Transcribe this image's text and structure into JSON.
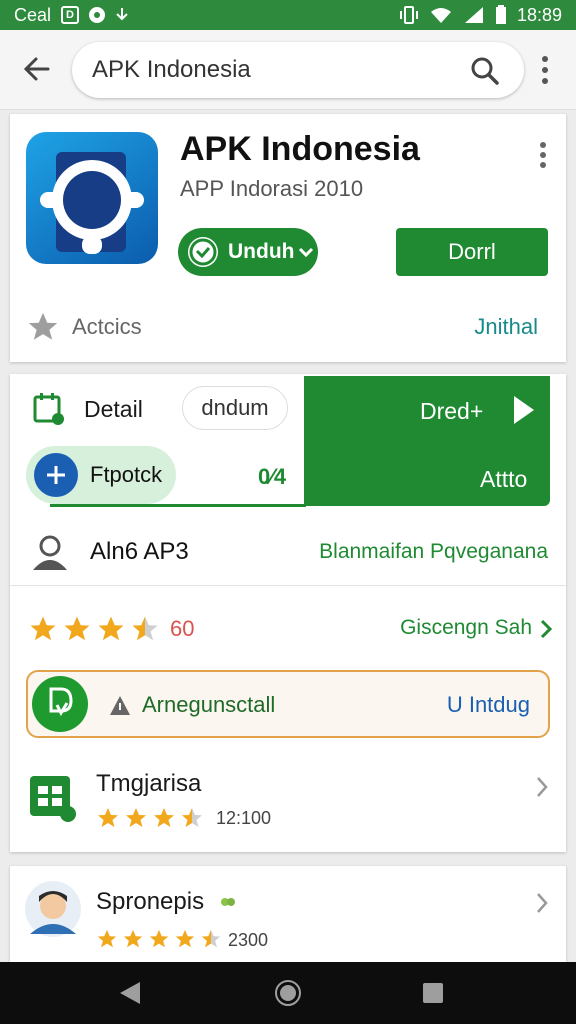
{
  "status_bar": {
    "carrier": "Ceal",
    "box_label": "D",
    "time": "18:89"
  },
  "search": {
    "value": "APK Indonesia"
  },
  "app": {
    "title": "APK Indonesia",
    "subtitle": "APP Indorasi 2010",
    "unduh_label": "Unduh",
    "install_label": "Dorrl",
    "actcics_label": "Actcics",
    "install_link": "Jnithal"
  },
  "details": {
    "detail_label": "Detail",
    "undum_label": "dndum",
    "panel_top_label": "Dred+",
    "panel_bottom_label": "Attto",
    "ftpotck_label": "Ftpotck",
    "percent": "0⁄4"
  },
  "aln_row": {
    "label": "Aln6 AP3",
    "value": "Blanmaifan Pqveganana"
  },
  "rating_row": {
    "rating": 3.5,
    "count": "60",
    "link": "Giscengn Sah"
  },
  "apk_row": {
    "label": "Arnegunsctall",
    "action": "U Intdug"
  },
  "list": [
    {
      "title": "Tmgjarisa",
      "rating": 3.5,
      "count": "12:100"
    },
    {
      "title": "Spronepis",
      "rating": 4.5,
      "count": "2300"
    }
  ],
  "colors": {
    "primary_green": "#1f8a32",
    "status_green": "#2e8b3e",
    "star": "#f2a81d",
    "link_teal": "#178a8a"
  }
}
